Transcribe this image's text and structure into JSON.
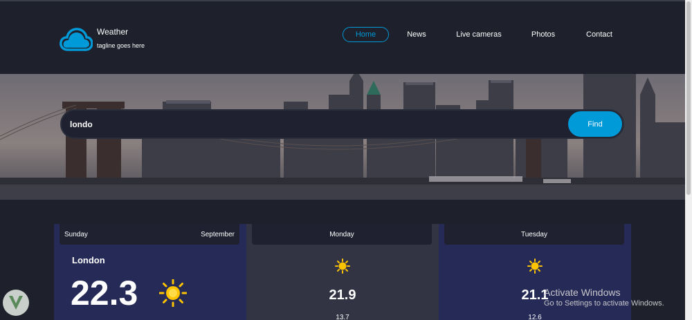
{
  "brand": {
    "title": "Weather",
    "tagline": "tagline goes here",
    "icon": "cloud-icon",
    "accent": "#009ad8"
  },
  "nav": {
    "items": [
      {
        "label": "Home",
        "active": true
      },
      {
        "label": "News"
      },
      {
        "label": "Live cameras"
      },
      {
        "label": "Photos"
      },
      {
        "label": "Contact"
      }
    ]
  },
  "search": {
    "value": "londo",
    "button_label": "Find"
  },
  "forecast": {
    "days": [
      {
        "day": "Sunday",
        "month": "September",
        "location": "London",
        "temp": "22.3",
        "icon": "sun-icon"
      },
      {
        "day": "Monday",
        "temp": "21.9",
        "low": "13.7",
        "icon": "sun-icon"
      },
      {
        "day": "Tuesday",
        "temp": "21.1",
        "low": "12.6",
        "icon": "sun-icon"
      }
    ]
  },
  "watermark": {
    "line1": "Activate Windows",
    "line2": "Go to Settings to activate Windows."
  },
  "colors": {
    "background": "#1e202b",
    "card_dark_blue": "#262a57",
    "card_gray": "#323444",
    "sun": "#ffc400"
  }
}
